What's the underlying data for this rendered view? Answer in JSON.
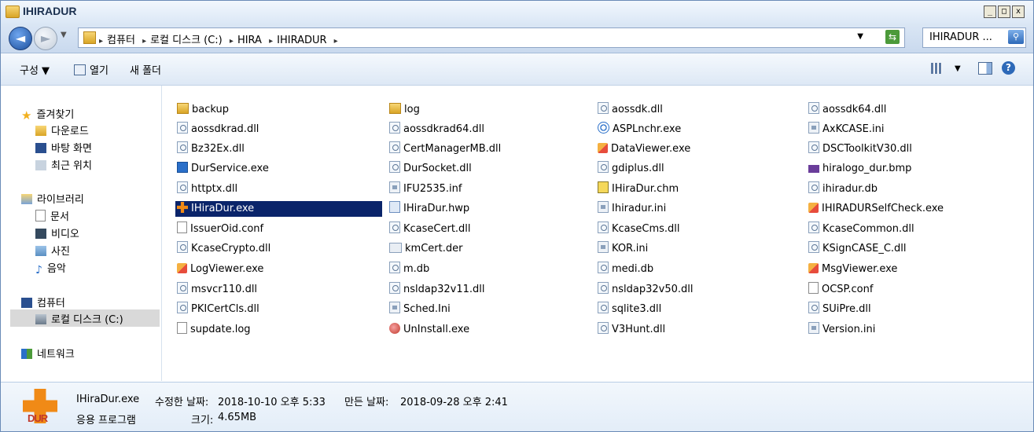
{
  "window": {
    "title": "IHIRADUR",
    "controls": [
      "_",
      "□",
      "x"
    ]
  },
  "address": {
    "crumbs": [
      "컴퓨터",
      "로컬 디스크 (C:)",
      "HIRA",
      "IHIRADUR"
    ],
    "search_text": "IHIRADUR ..."
  },
  "toolbar": {
    "organize": "구성 ▼",
    "open": "열기",
    "new_folder": "새 폴더"
  },
  "nav": {
    "favorites": "즐겨찾기",
    "downloads": "다운로드",
    "desktop": "바탕 화면",
    "recent": "최근 위치",
    "libraries": "라이브러리",
    "documents": "문서",
    "videos": "비디오",
    "pictures": "사진",
    "music": "음악",
    "computer": "컴퓨터",
    "local_disk": "로컬 디스크 (C:)",
    "network": "네트워크"
  },
  "files": [
    [
      "backup",
      "log",
      "aossdk.dll",
      "aossdk64.dll"
    ],
    [
      "aossdkrad.dll",
      "aossdkrad64.dll",
      "ASPLnchr.exe",
      "AxKCASE.ini"
    ],
    [
      "Bz32Ex.dll",
      "CertManagerMB.dll",
      "DataViewer.exe",
      "DSCToolkitV30.dll"
    ],
    [
      "DurService.exe",
      "DurSocket.dll",
      "gdiplus.dll",
      "hiralogo_dur.bmp"
    ],
    [
      "httptx.dll",
      "IFU2535.inf",
      "IHiraDur.chm",
      "ihiradur.db"
    ],
    [
      "IHiraDur.exe",
      "IHiraDur.hwp",
      "Ihiradur.ini",
      "IHIRADURSelfCheck.exe"
    ],
    [
      "IssuerOid.conf",
      "KcaseCert.dll",
      "KcaseCms.dll",
      "KcaseCommon.dll"
    ],
    [
      "KcaseCrypto.dll",
      "kmCert.der",
      "KOR.ini",
      "KSignCASE_C.dll"
    ],
    [
      "LogViewer.exe",
      "m.db",
      "medi.db",
      "MsgViewer.exe"
    ],
    [
      "msvcr110.dll",
      "nsldap32v11.dll",
      "nsldap32v50.dll",
      "OCSP.conf"
    ],
    [
      "PKICertCls.dll",
      "Sched.Ini",
      "sqlite3.dll",
      "SUiPre.dll"
    ],
    [
      "supdate.log",
      "UnInstall.exe",
      "V3Hunt.dll",
      "Version.ini"
    ]
  ],
  "details": {
    "filename": "IHiraDur.exe",
    "modified_label": "수정한 날짜:",
    "modified": "2018-10-10 오후 5:33",
    "created_label": "만든 날짜:",
    "created": "2018-09-28 오후 2:41",
    "type": "응용 프로그램",
    "size_label": "크기:",
    "size": "4.65MB",
    "icon_text": "DUR"
  }
}
